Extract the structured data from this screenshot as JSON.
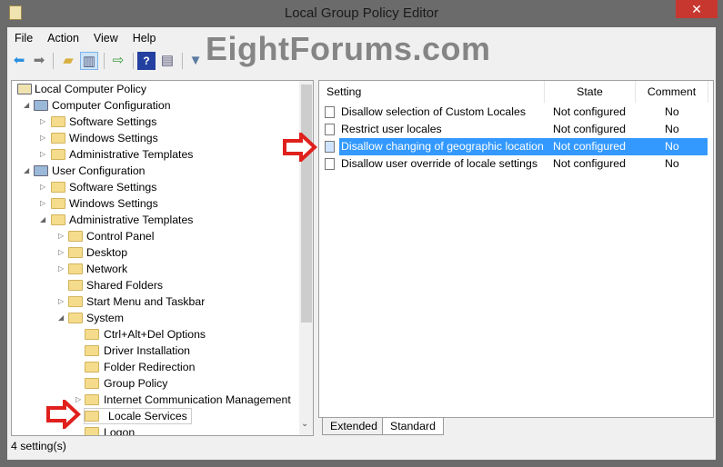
{
  "window": {
    "title": "Local Group Policy Editor",
    "close": "✕"
  },
  "watermark": "EightForums.com",
  "menu": [
    "File",
    "Action",
    "View",
    "Help"
  ],
  "toolbar": {
    "icons": [
      "back-arrow-icon",
      "forward-arrow-icon",
      "up-folder-icon",
      "show-hide-tree-icon",
      "export-list-icon",
      "help-icon",
      "action-pane-icon",
      "filter-icon"
    ]
  },
  "tree": [
    {
      "label": "Local Computer Policy",
      "level": 0,
      "arrow": ""
    },
    {
      "label": "Computer Configuration",
      "level": 1,
      "arrow": "◢"
    },
    {
      "label": "Software Settings",
      "level": 2,
      "arrow": "▷"
    },
    {
      "label": "Windows Settings",
      "level": 2,
      "arrow": "▷"
    },
    {
      "label": "Administrative Templates",
      "level": 2,
      "arrow": "▷"
    },
    {
      "label": "User Configuration",
      "level": 1,
      "arrow": "◢"
    },
    {
      "label": "Software Settings",
      "level": 2,
      "arrow": "▷"
    },
    {
      "label": "Windows Settings",
      "level": 2,
      "arrow": "▷"
    },
    {
      "label": "Administrative Templates",
      "level": 2,
      "arrow": "◢"
    },
    {
      "label": "Control Panel",
      "level": 3,
      "arrow": "▷"
    },
    {
      "label": "Desktop",
      "level": 3,
      "arrow": "▷"
    },
    {
      "label": "Network",
      "level": 3,
      "arrow": "▷"
    },
    {
      "label": "Shared Folders",
      "level": 3,
      "arrow": ""
    },
    {
      "label": "Start Menu and Taskbar",
      "level": 3,
      "arrow": "▷"
    },
    {
      "label": "System",
      "level": 3,
      "arrow": "◢"
    },
    {
      "label": "Ctrl+Alt+Del Options",
      "level": 4,
      "arrow": ""
    },
    {
      "label": "Driver Installation",
      "level": 4,
      "arrow": ""
    },
    {
      "label": "Folder Redirection",
      "level": 4,
      "arrow": ""
    },
    {
      "label": "Group Policy",
      "level": 4,
      "arrow": ""
    },
    {
      "label": "Internet Communication Management",
      "level": 4,
      "arrow": "▷"
    },
    {
      "label": "Locale Services",
      "level": 4,
      "arrow": "",
      "selected": true
    },
    {
      "label": "Logon",
      "level": 4,
      "arrow": ""
    }
  ],
  "list": {
    "columns": [
      "Setting",
      "State",
      "Comment"
    ],
    "rows": [
      {
        "setting": "Disallow selection of Custom Locales",
        "state": "Not configured",
        "comment": "No"
      },
      {
        "setting": "Restrict user locales",
        "state": "Not configured",
        "comment": "No"
      },
      {
        "setting": "Disallow changing of geographic location",
        "state": "Not configured",
        "comment": "No",
        "selected": true
      },
      {
        "setting": "Disallow user override of locale settings",
        "state": "Not configured",
        "comment": "No"
      }
    ]
  },
  "tabs": [
    "Extended",
    "Standard"
  ],
  "status": "4 setting(s)",
  "colors": {
    "selection": "#3399ff",
    "annotation_arrow": "#e0201c",
    "close": "#c7372f"
  }
}
